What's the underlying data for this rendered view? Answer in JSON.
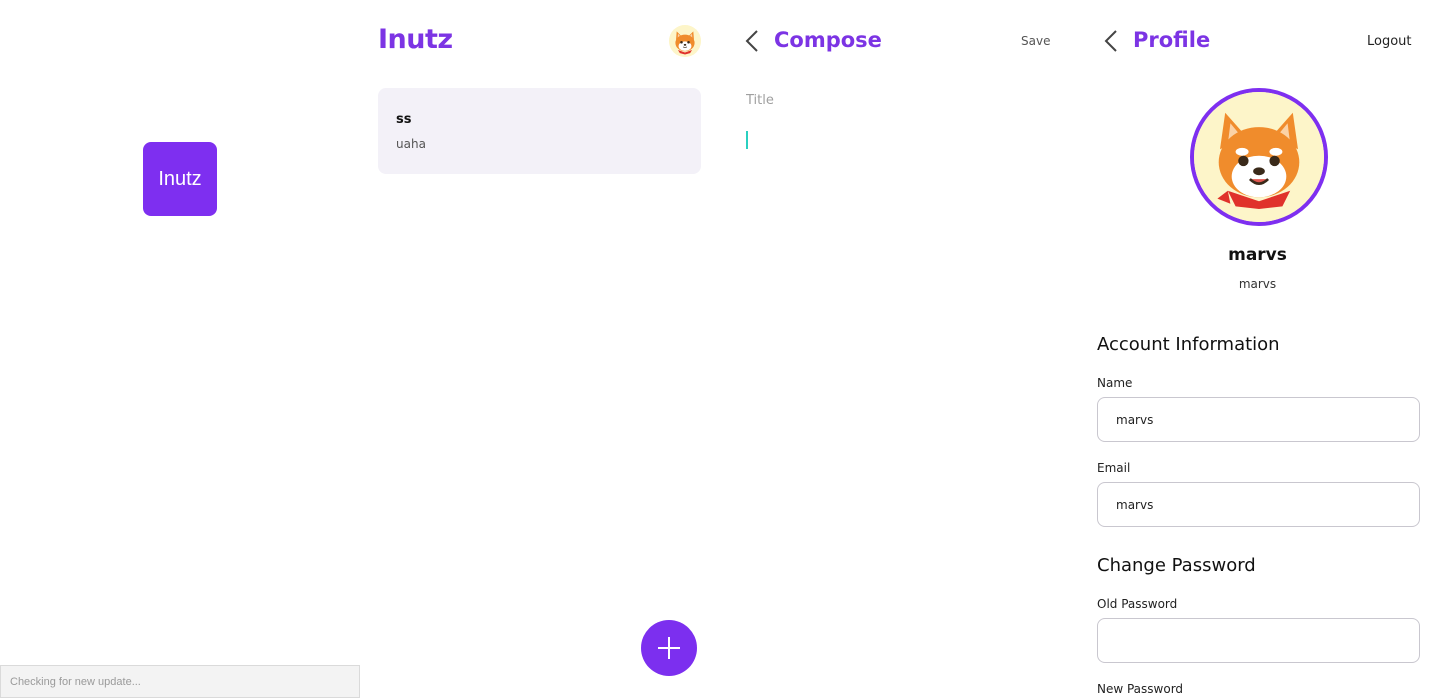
{
  "splash": {
    "logo_text": "Inutz",
    "update_status": "Checking for new update..."
  },
  "notes": {
    "app_title": "Inutz",
    "items": [
      {
        "title": "ss",
        "body": "uaha"
      }
    ],
    "fab_icon": "plus-icon"
  },
  "compose": {
    "title": "Compose",
    "save_label": "Save",
    "title_placeholder": "Title",
    "back_icon": "chevron-left-icon"
  },
  "profile": {
    "title": "Profile",
    "logout_label": "Logout",
    "display_name": "marvs",
    "username": "marvs",
    "account_heading": "Account Information",
    "name_label": "Name",
    "name_value": "marvs",
    "email_label": "Email",
    "email_value": "marvs",
    "password_heading": "Change Password",
    "old_password_label": "Old Password",
    "old_password_value": "",
    "new_password_label": "New Password"
  },
  "colors": {
    "primary": "#7e2ff0",
    "card_background": "#f3f1f8",
    "caret": "#2ad0c0",
    "avatar_border": "#7e2ff0"
  }
}
